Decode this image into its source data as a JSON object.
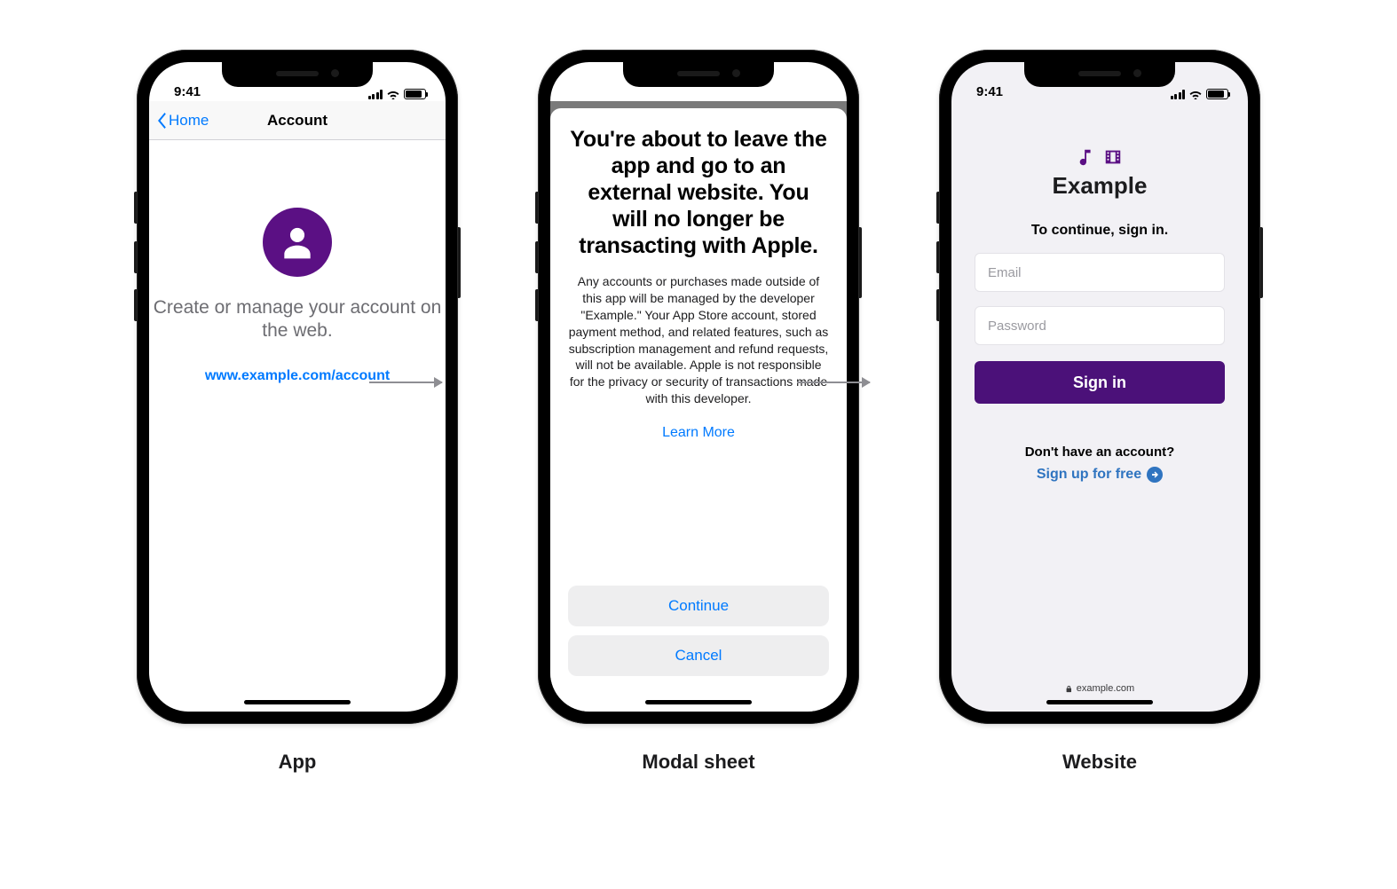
{
  "status": {
    "time": "9:41"
  },
  "captions": {
    "app": "App",
    "modal": "Modal sheet",
    "web": "Website"
  },
  "app": {
    "nav_back": "Home",
    "nav_title": "Account",
    "message": "Create or manage your account on the web.",
    "link": "www.example.com/account"
  },
  "modal": {
    "title": "You're about to leave the app and go to an external website. You will no longer be transacting with Apple.",
    "body": "Any accounts or purchases made outside of this app will be managed by the developer \"Example.\" Your App Store account, stored payment method, and related features, such as subscription management and refund requests, will not be available. Apple is not responsible for the privacy or security of transactions made with this developer.",
    "learn_more": "Learn More",
    "continue": "Continue",
    "cancel": "Cancel"
  },
  "web": {
    "brand": "Example",
    "subtitle": "To continue, sign in.",
    "email_placeholder": "Email",
    "password_placeholder": "Password",
    "signin": "Sign in",
    "no_account": "Don't have an account?",
    "signup": "Sign up for free",
    "domain": "example.com"
  }
}
